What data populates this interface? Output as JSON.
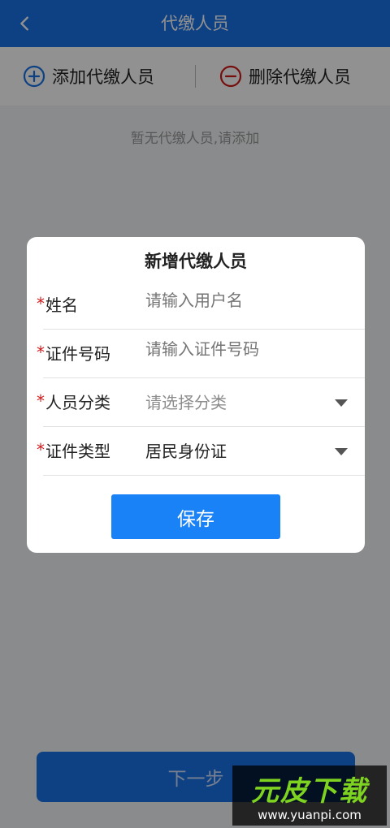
{
  "header": {
    "title": "代缴人员",
    "back_icon": "chevron-left-icon",
    "background": "#1a73e8"
  },
  "actions": {
    "add_label": "添加代缴人员",
    "add_icon": "plus-circle-icon",
    "add_color": "#1a73e8",
    "delete_label": "删除代缴人员",
    "delete_icon": "minus-circle-icon",
    "delete_color": "#d11a1a"
  },
  "empty_text": "暂无代缴人员,请添加",
  "next_button": "下一步",
  "dialog": {
    "title": "新增代缴人员",
    "required_mark": "*",
    "fields": [
      {
        "label": "姓名",
        "placeholder": "请输入用户名",
        "value": "",
        "type": "input"
      },
      {
        "label": "证件号码",
        "placeholder": "请输入证件号码",
        "value": "",
        "type": "input"
      },
      {
        "label": "人员分类",
        "placeholder": "请选择分类",
        "value": "",
        "type": "select"
      },
      {
        "label": "证件类型",
        "placeholder": "",
        "value": "居民身份证",
        "type": "select"
      }
    ],
    "save_label": "保存"
  },
  "watermark": {
    "title": "元皮下载",
    "url": "www.yuanpi.com"
  }
}
